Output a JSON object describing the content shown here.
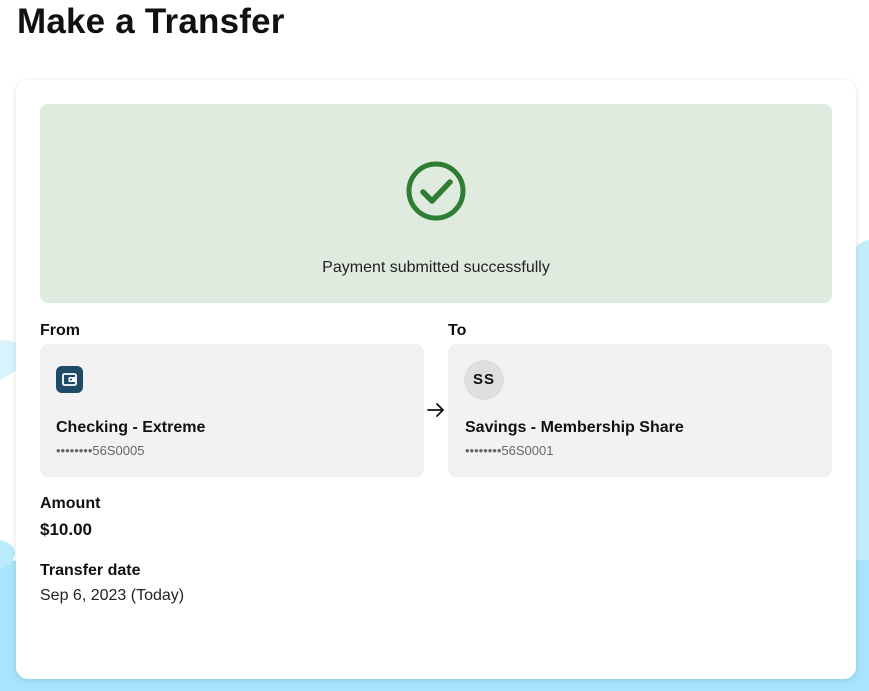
{
  "page": {
    "title": "Make a Transfer"
  },
  "banner": {
    "icon": "check-circle-icon",
    "message": "Payment submitted successfully"
  },
  "from": {
    "label": "From",
    "icon": "wallet-icon",
    "account_name": "Checking - Extreme",
    "account_number": "••••••••56S0005"
  },
  "to": {
    "label": "To",
    "avatar_initials": "SS",
    "account_name": "Savings - Membership Share",
    "account_number": "••••••••56S0001"
  },
  "amount": {
    "label": "Amount",
    "value": "$10.00"
  },
  "transfer_date": {
    "label": "Transfer date",
    "value": "Sep 6, 2023 (Today)"
  },
  "colors": {
    "success_bg": "#e0ebe0",
    "success_icon": "#2e7d32",
    "wallet_icon_bg": "#1f4a68",
    "background_wave": "#a8e4fb"
  }
}
